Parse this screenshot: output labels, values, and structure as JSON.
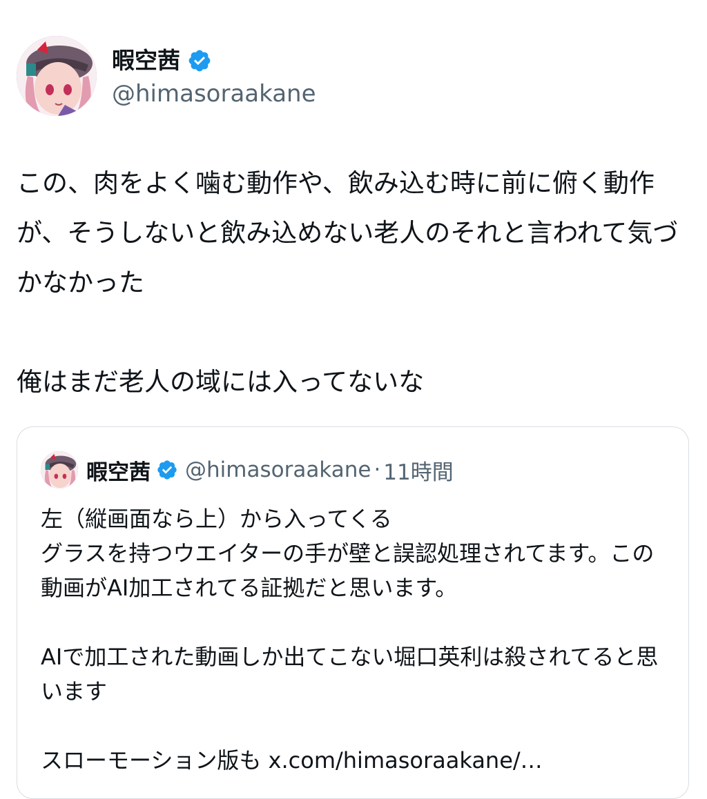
{
  "tweet": {
    "author": {
      "display_name": "暇空茜",
      "handle": "@himasoraakane",
      "verified_color": "#1d9bf0"
    },
    "text": "この、肉をよく噛む動作や、飲み込む時に前に俯く動作が、そうしないと飲み込めない老人のそれと言われて気づかなかった\n\n俺はまだ老人の域には入ってないな"
  },
  "quoted_tweet": {
    "author": {
      "display_name": "暇空茜",
      "handle": "@himasoraakane"
    },
    "separator": "·",
    "time": "11時間",
    "text": "左（縦画面なら上）から入ってくる\nグラスを持つウエイターの手が壁と誤認処理されてます。この動画がAI加工されてる証拠だと思います。\n\nAIで加工された動画しか出てこない堀口英利は殺されてると思います\n\nスローモーション版も x.com/himasoraakane/…"
  }
}
